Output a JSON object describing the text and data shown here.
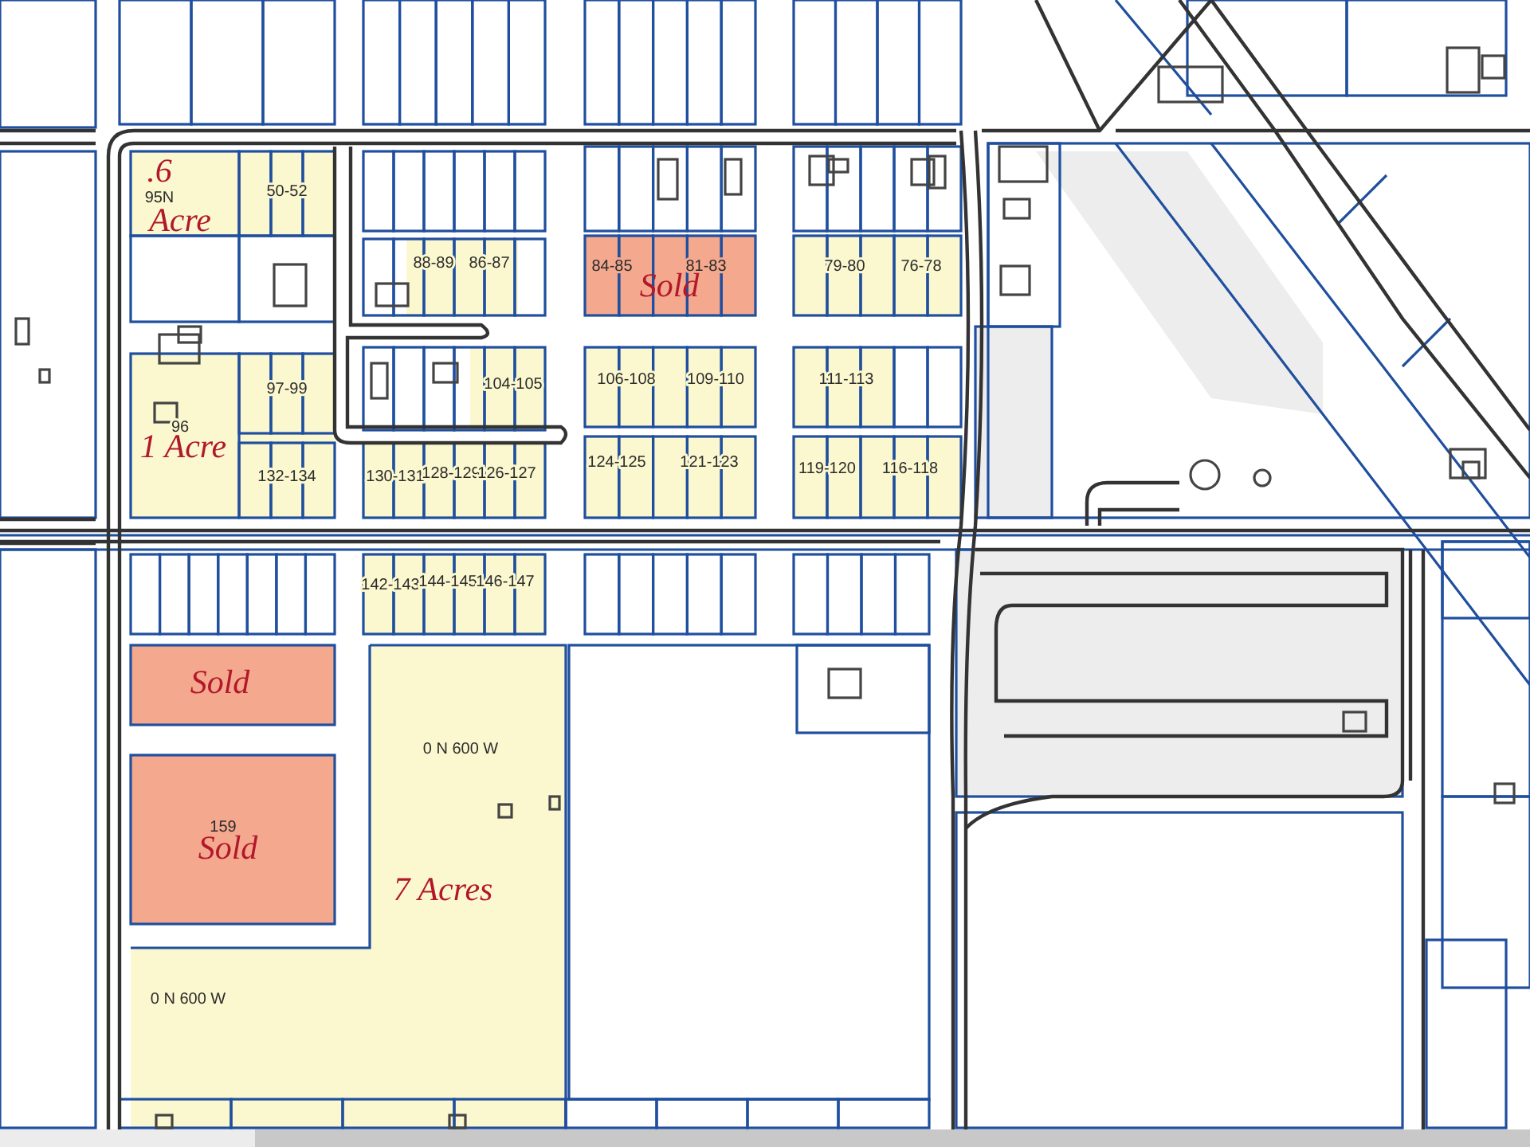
{
  "map": {
    "parcels": [
      {
        "sold": false,
        "labels": [
          {
            "text": ".6",
            "kind": "acreage"
          },
          {
            "text": "95N",
            "kind": "lot"
          },
          {
            "text": "Acre",
            "kind": "acreage"
          },
          {
            "text": "50-52",
            "kind": "lot"
          }
        ]
      },
      {
        "sold": false,
        "labels": [
          {
            "text": "88-89",
            "kind": "lot"
          },
          {
            "text": "86-87",
            "kind": "lot"
          }
        ]
      },
      {
        "sold": true,
        "labels": [
          {
            "text": "84-85",
            "kind": "lot"
          },
          {
            "text": "81-83",
            "kind": "lot"
          },
          {
            "text": "Sold",
            "kind": "acreage"
          }
        ]
      },
      {
        "sold": false,
        "labels": [
          {
            "text": "79-80",
            "kind": "lot"
          },
          {
            "text": "76-78",
            "kind": "lot"
          }
        ]
      },
      {
        "sold": false,
        "labels": [
          {
            "text": "97-99",
            "kind": "lot"
          },
          {
            "text": "96",
            "kind": "lot"
          },
          {
            "text": "1 Acre",
            "kind": "acreage"
          },
          {
            "text": "132-134",
            "kind": "lot"
          }
        ]
      },
      {
        "sold": false,
        "labels": [
          {
            "text": "104-105",
            "kind": "lot"
          }
        ]
      },
      {
        "sold": false,
        "labels": [
          {
            "text": "106-108",
            "kind": "lot"
          },
          {
            "text": "109-110",
            "kind": "lot"
          }
        ]
      },
      {
        "sold": false,
        "labels": [
          {
            "text": "111-113",
            "kind": "lot"
          }
        ]
      },
      {
        "sold": false,
        "labels": [
          {
            "text": "130-131",
            "kind": "lot"
          },
          {
            "text": "128-129",
            "kind": "lot"
          },
          {
            "text": "126-127",
            "kind": "lot"
          }
        ]
      },
      {
        "sold": false,
        "labels": [
          {
            "text": "124-125",
            "kind": "lot"
          },
          {
            "text": "121-123",
            "kind": "lot"
          }
        ]
      },
      {
        "sold": false,
        "labels": [
          {
            "text": "119-120",
            "kind": "lot"
          },
          {
            "text": "116-118",
            "kind": "lot"
          }
        ]
      },
      {
        "sold": false,
        "labels": [
          {
            "text": "142-143",
            "kind": "lot"
          },
          {
            "text": "144-145",
            "kind": "lot"
          },
          {
            "text": "146-147",
            "kind": "lot"
          }
        ]
      },
      {
        "sold": true,
        "labels": [
          {
            "text": "Sold",
            "kind": "acreage"
          }
        ]
      },
      {
        "sold": true,
        "labels": [
          {
            "text": "159",
            "kind": "lot"
          },
          {
            "text": "Sold",
            "kind": "acreage"
          }
        ]
      },
      {
        "sold": false,
        "labels": [
          {
            "text": "0 N 600 W",
            "kind": "lot"
          },
          {
            "text": "7 Acres",
            "kind": "acreage"
          },
          {
            "text": "0 N 600 W",
            "kind": "lot"
          }
        ]
      }
    ]
  }
}
